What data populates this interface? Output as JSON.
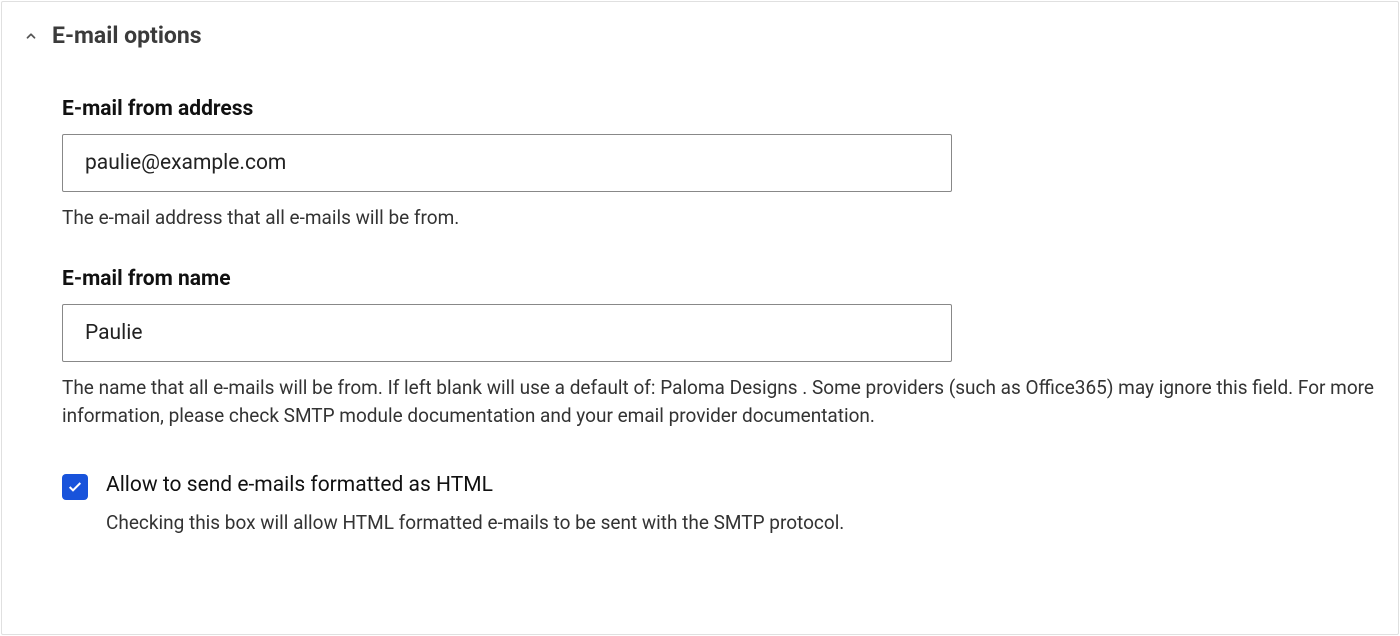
{
  "section": {
    "title": "E-mail options"
  },
  "fields": {
    "from_address": {
      "label": "E-mail from address",
      "value": "paulie@example.com",
      "help": "The e-mail address that all e-mails will be from."
    },
    "from_name": {
      "label": "E-mail from name",
      "value": "Paulie",
      "help": "The name that all e-mails will be from. If left blank will use a default of: Paloma Designs . Some providers (such as Office365) may ignore this field. For more information, please check SMTP module documentation and your email provider documentation."
    },
    "html_checkbox": {
      "checked": true,
      "label": "Allow to send e-mails formatted as HTML",
      "help": "Checking this box will allow HTML formatted e-mails to be sent with the SMTP protocol."
    }
  }
}
